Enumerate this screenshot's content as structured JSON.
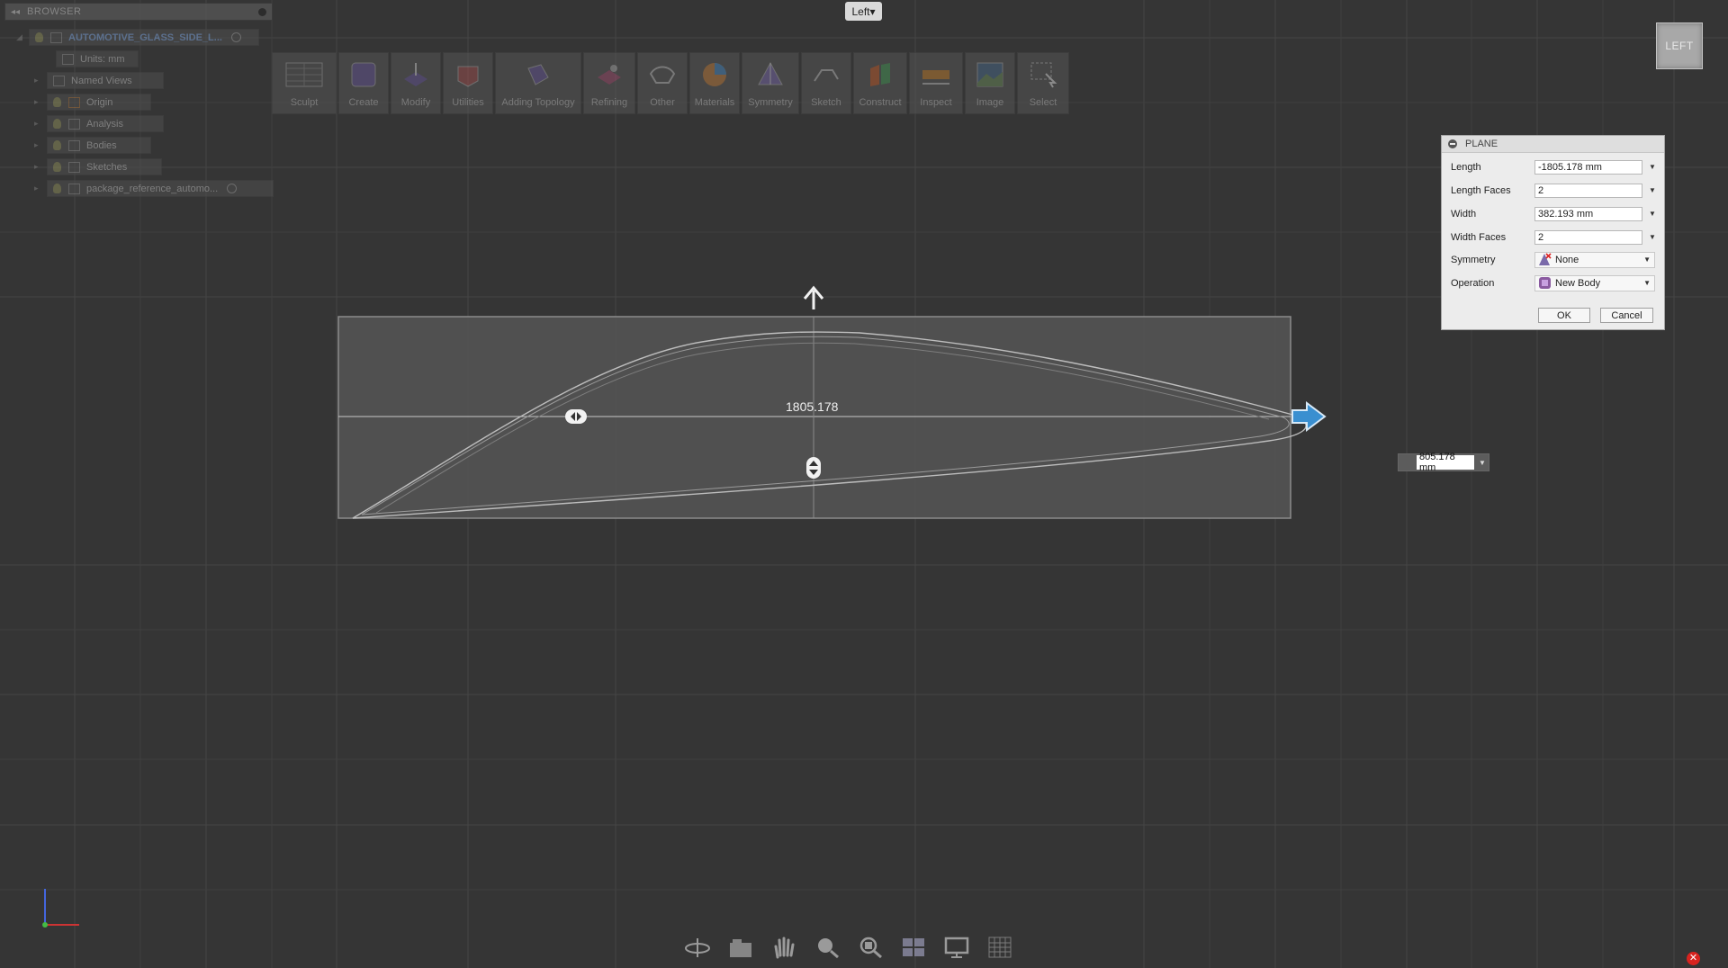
{
  "browser": {
    "title": "BROWSER",
    "items": [
      {
        "label": "AUTOMOTIVE_GLASS_SIDE_L..."
      },
      {
        "label": "Units: mm"
      },
      {
        "label": "Named Views"
      },
      {
        "label": "Origin"
      },
      {
        "label": "Analysis"
      },
      {
        "label": "Bodies"
      },
      {
        "label": "Sketches"
      },
      {
        "label": "package_reference_automo..."
      }
    ]
  },
  "view_dropdown": {
    "label": "Left",
    "arrow": "▾"
  },
  "toolbar": {
    "items": [
      {
        "label": "Sculpt",
        "icon": "sculpt-icon"
      },
      {
        "label": "Create",
        "icon": "create-icon"
      },
      {
        "label": "Modify",
        "icon": "modify-icon"
      },
      {
        "label": "Utilities",
        "icon": "utilities-icon"
      },
      {
        "label": "Adding Topology",
        "icon": "topology-icon"
      },
      {
        "label": "Refining",
        "icon": "refining-icon"
      },
      {
        "label": "Other",
        "icon": "other-icon"
      },
      {
        "label": "Materials",
        "icon": "materials-icon"
      },
      {
        "label": "Symmetry",
        "icon": "symmetry-icon"
      },
      {
        "label": "Sketch",
        "icon": "sketch-icon"
      },
      {
        "label": "Construct",
        "icon": "construct-icon"
      },
      {
        "label": "Inspect",
        "icon": "inspect-icon"
      },
      {
        "label": "Image",
        "icon": "image-icon"
      },
      {
        "label": "Select",
        "icon": "select-icon"
      }
    ]
  },
  "viewcube": {
    "face": "LEFT"
  },
  "canvas": {
    "dimension_label": "1805.178"
  },
  "plane_dialog": {
    "title": "PLANE",
    "rows": {
      "length": {
        "label": "Length",
        "value": "-1805.178 mm"
      },
      "length_faces": {
        "label": "Length Faces",
        "value": "2"
      },
      "width": {
        "label": "Width",
        "value": "382.193 mm"
      },
      "width_faces": {
        "label": "Width Faces",
        "value": "2"
      },
      "symmetry": {
        "label": "Symmetry",
        "value": "None"
      },
      "operation": {
        "label": "Operation",
        "value": "New Body"
      }
    },
    "ok_label": "OK",
    "cancel_label": "Cancel"
  },
  "value_input": {
    "value": "805.178 mm"
  },
  "navbar": {
    "icons": [
      "orbit-icon",
      "camera-icon",
      "pan-hand-icon",
      "zoom-icon",
      "fit-icon",
      "display-settings-icon",
      "monitor-icon",
      "grid-icon"
    ]
  },
  "close_icon": "✕",
  "colors": {
    "background": "#353535",
    "accent": "#3a8fd0",
    "dialog": "#ececec",
    "close": "#d8231f"
  }
}
